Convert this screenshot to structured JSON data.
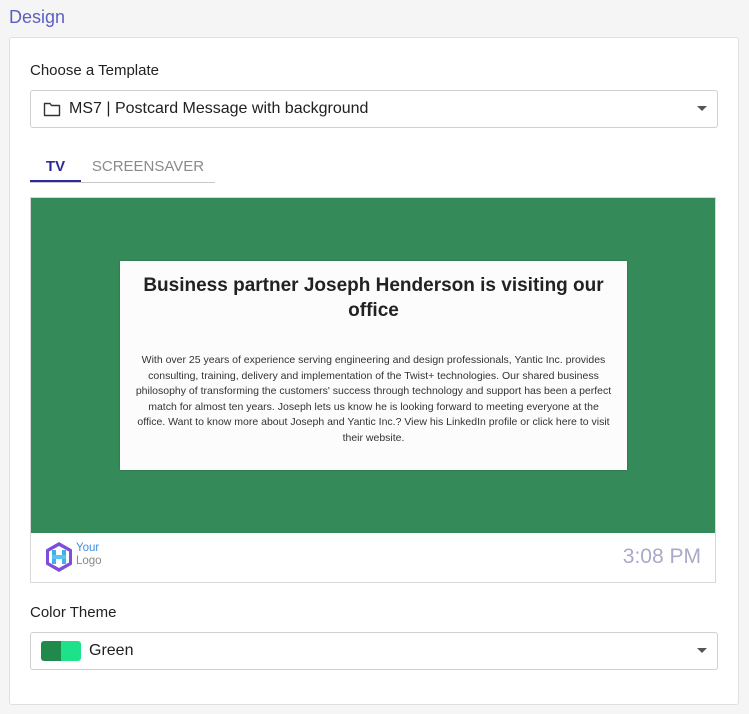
{
  "section": {
    "title": "Design"
  },
  "template": {
    "label": "Choose a Template",
    "selected": "MS7 | Postcard Message with background"
  },
  "tabs": [
    {
      "label": "TV",
      "active": true
    },
    {
      "label": "SCREENSAVER",
      "active": false
    }
  ],
  "preview": {
    "background_color": "#358a5a",
    "title": "Business partner Joseph Henderson is visiting our office",
    "body": "With over 25 years of experience serving engineering and design professionals, Yantic Inc. provides consulting, training, delivery and implementation of the Twist+ technologies. Our shared business philosophy of transforming the customers' success through technology and support has been a perfect match for almost ten years. Joseph lets us know he is looking forward to meeting everyone at the office. Want to know more about Joseph and Yantic Inc.? View his LinkedIn profile or click here to visit their website.",
    "logo_line1": "Your",
    "logo_line2": "Logo",
    "time": "3:08 PM"
  },
  "color_theme": {
    "label": "Color Theme",
    "selected": "Green",
    "swatch_colors": [
      "#1f8a4c",
      "#1de28a"
    ]
  },
  "icons": {
    "template_icon": "folder-icon",
    "dropdown_icon": "chevron-down-icon"
  }
}
